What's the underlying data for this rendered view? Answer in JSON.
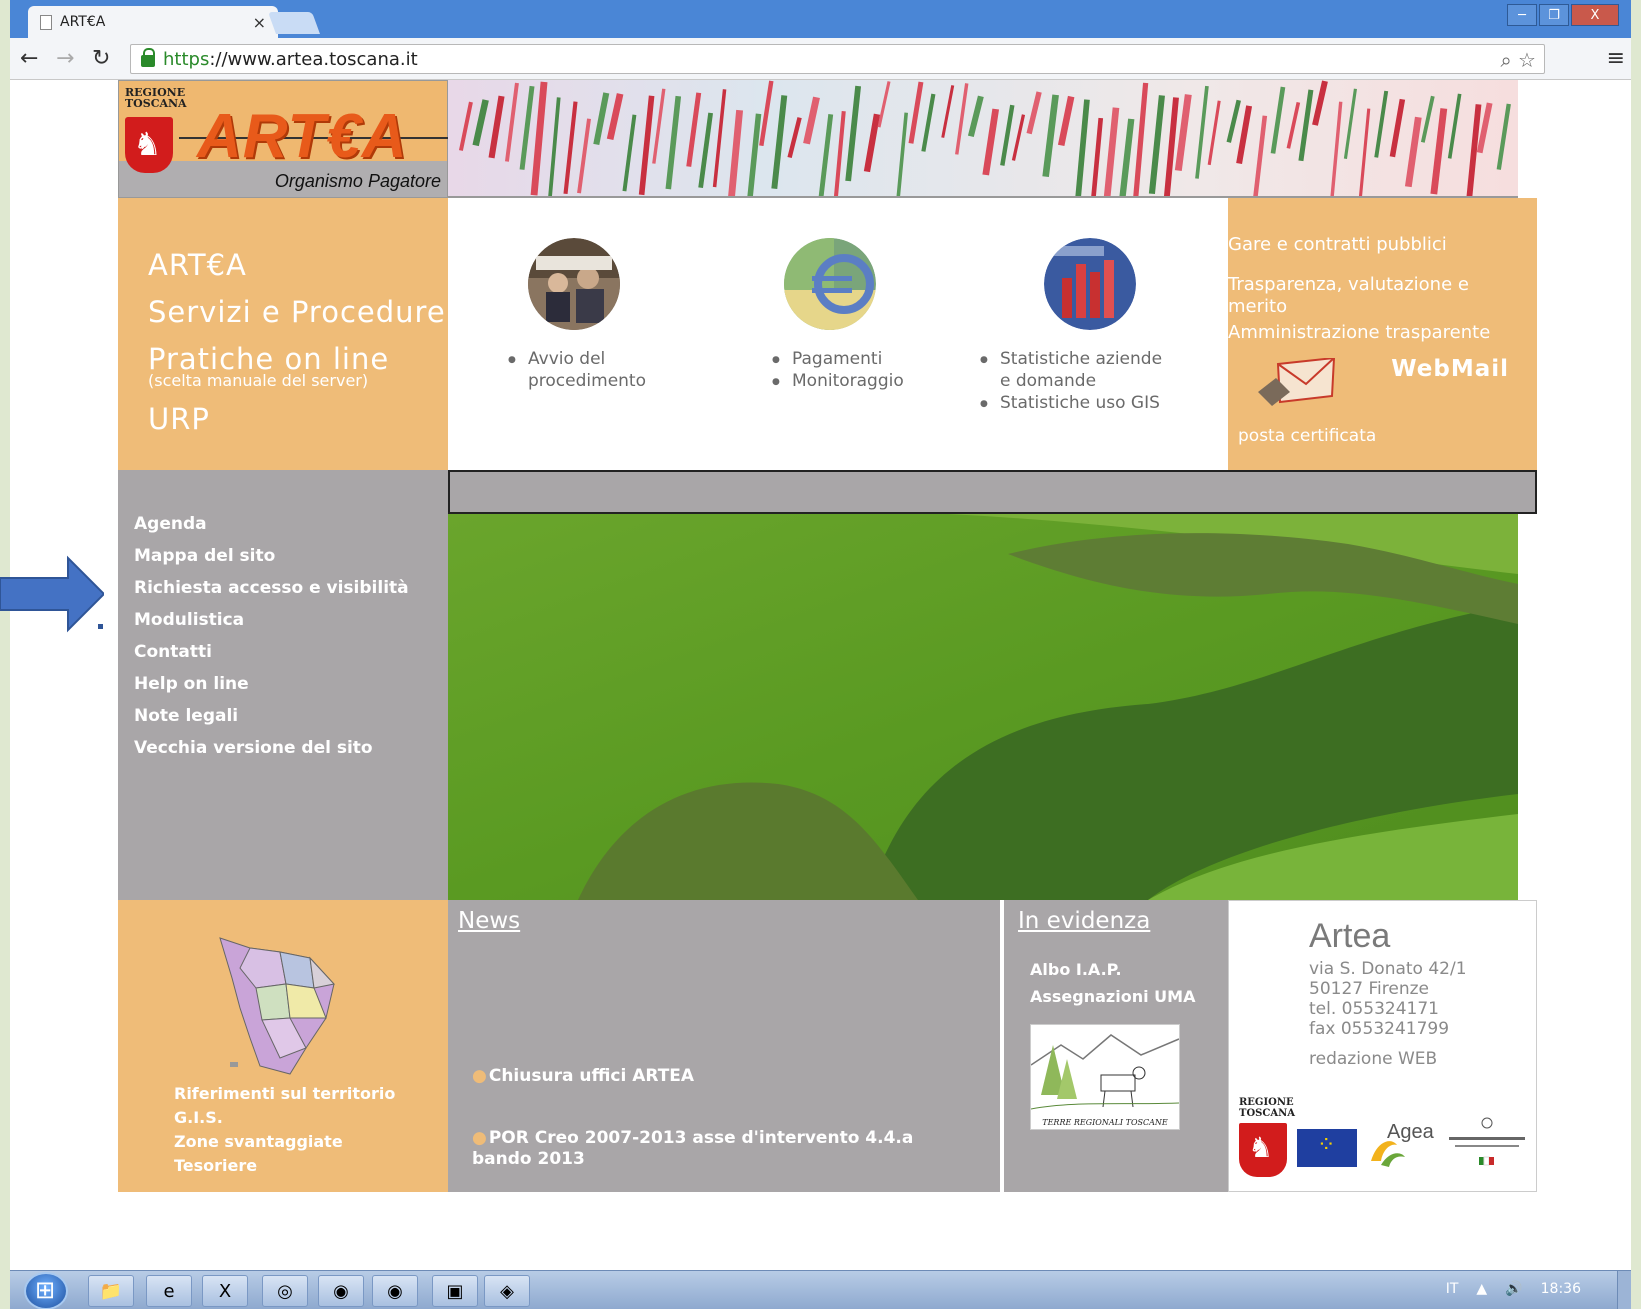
{
  "browser": {
    "tab_title": "ART€A",
    "tab_close": "×",
    "url_https": "https",
    "url_rest": "://www.artea.toscana.it",
    "window_buttons": [
      "─",
      "❐",
      "X"
    ]
  },
  "header": {
    "regione_line1": "REGIONE",
    "regione_line2": "TOSCANA",
    "logo_text": "ART€A",
    "logo_subtitle": "Organismo Pagatore"
  },
  "main_menu": {
    "items": [
      {
        "label": "ART€A"
      },
      {
        "label": "Servizi e Procedure"
      },
      {
        "label": "Pratiche on line",
        "note": "(scelta manuale del server)"
      },
      {
        "label": "URP"
      }
    ]
  },
  "services": [
    {
      "items": [
        "Avvio del",
        "procedimento"
      ],
      "icon": "meeting-photo-icon"
    },
    {
      "items": [
        "Pagamenti",
        "Monitoraggio"
      ],
      "icon": "euro-payments-icon"
    },
    {
      "items": [
        "Statistiche aziende",
        "e domande",
        "Statistiche uso GIS"
      ],
      "icon": "statistics-chart-icon"
    }
  ],
  "right_links": {
    "gare": "Gare e contratti pubblici",
    "trasparenza": "Trasparenza, valutazione e merito",
    "amministrazione": "Amministrazione trasparente",
    "webmail": "WebMail",
    "pec": "posta certificata"
  },
  "left_nav": [
    "Agenda",
    "Mappa del sito",
    "Richiesta accesso e visibilità",
    "Modulistica",
    "Contatti",
    "Help on line",
    "Note legali",
    "Vecchia versione del sito"
  ],
  "territory_links": [
    "Riferimenti sul territorio",
    "G.I.S.",
    "Zone svantaggiate",
    "Tesoriere"
  ],
  "news": {
    "heading": "News",
    "items": [
      "Chiusura uffici ARTEA",
      "POR Creo 2007-2013 asse d'intervento 4.4.a bando 2013"
    ]
  },
  "evidenza": {
    "heading": "In evidenza",
    "links": [
      "Albo I.A.P.",
      "Assegnazioni UMA"
    ],
    "image_caption": "TERRE REGIONALI TOSCANE"
  },
  "contact": {
    "title": "Artea",
    "address": "via S. Donato 42/1",
    "city": "50127 Firenze",
    "tel": "tel. 055324171",
    "fax": "fax 0553241799",
    "redazione": "redazione WEB",
    "agea": "Agea"
  },
  "taskbar": {
    "language": "IT",
    "clock": "18:36"
  },
  "colors": {
    "orange": "#efbc78",
    "gray": "#a9a6a8",
    "arrow": "#4472c4"
  }
}
